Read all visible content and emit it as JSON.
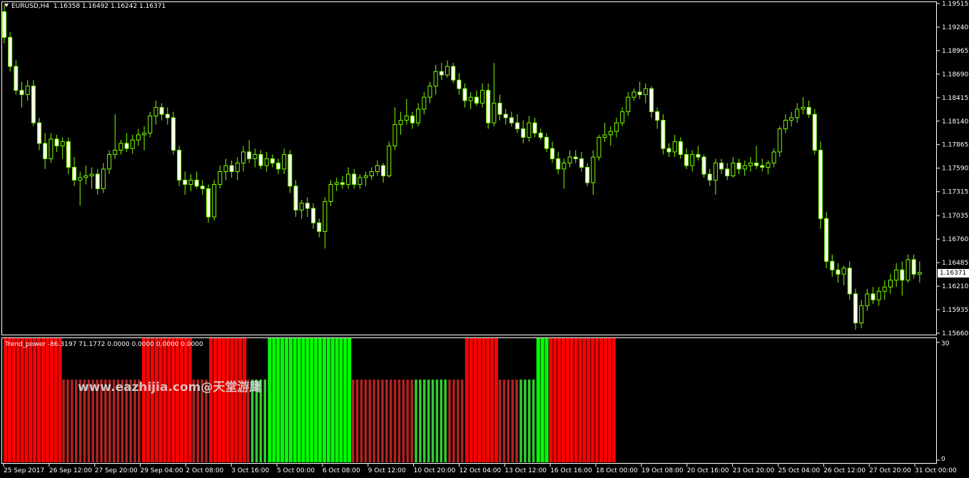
{
  "header": {
    "symbol": "EURUSD,H4",
    "ohlc": "1.16358 1.16492 1.16242 1.16371"
  },
  "price_axis": {
    "ticks": [
      "1.19515",
      "1.19240",
      "1.18965",
      "1.18690",
      "1.18415",
      "1.18140",
      "1.17865",
      "1.17590",
      "1.17315",
      "1.17035",
      "1.16760",
      "1.16485",
      "1.16210",
      "1.15935",
      "1.15660"
    ],
    "last_price": "1.16371"
  },
  "time_axis": {
    "labels": [
      "25 Sep 2017",
      "26 Sep 12:00",
      "27 Sep 20:00",
      "29 Sep 04:00",
      "2 Oct 08:00",
      "3 Oct 16:00",
      "5 Oct 00:00",
      "6 Oct 08:00",
      "9 Oct 12:00",
      "10 Oct 20:00",
      "12 Oct 04:00",
      "13 Oct 12:00",
      "16 Oct 16:00",
      "18 Oct 00:00",
      "19 Oct 08:00",
      "20 Oct 16:00",
      "23 Oct 20:00",
      "25 Oct 04:00",
      "26 Oct 12:00",
      "27 Oct 20:00",
      "31 Oct 00:00"
    ]
  },
  "indicator": {
    "header": "Trend_power -86.3197 71.1772 0.0000 0.0000 0.0000 0.0000",
    "axis_max": "30",
    "axis_min": "0"
  },
  "watermark": "www.eazhijia.com@天堂游鹰",
  "colors": {
    "background": "#000000",
    "candle": "#7CFC00",
    "candle_body_bull": "#000000",
    "candle_body_bear": "#ffffff",
    "strong_down": "#ff0000",
    "weak_down": "#b22222",
    "strong_up": "#00ff00",
    "weak_up": "#32cd32",
    "axis": "#ffffff"
  },
  "chart_data": {
    "type": "candlestick",
    "price_range": [
      1.1566,
      1.19515
    ],
    "indicator_range": [
      0,
      30
    ],
    "indicator_levels": {
      "strong": 30,
      "weak": 20
    },
    "candles": [
      [
        1.1942,
        1.195,
        1.1905,
        1.1912
      ],
      [
        1.1912,
        1.1918,
        1.1872,
        1.1878
      ],
      [
        1.1878,
        1.1885,
        1.1845,
        1.185
      ],
      [
        1.185,
        1.186,
        1.183,
        1.1845
      ],
      [
        1.1845,
        1.1862,
        1.1838,
        1.1855
      ],
      [
        1.1855,
        1.1862,
        1.1808,
        1.1812
      ],
      [
        1.1812,
        1.1818,
        1.178,
        1.1788
      ],
      [
        1.1788,
        1.18,
        1.1758,
        1.177
      ],
      [
        1.177,
        1.18,
        1.1765,
        1.1793
      ],
      [
        1.1793,
        1.1798,
        1.1778,
        1.1785
      ],
      [
        1.1785,
        1.1795,
        1.177,
        1.179
      ],
      [
        1.179,
        1.1795,
        1.1752,
        1.176
      ],
      [
        1.176,
        1.1772,
        1.1738,
        1.1745
      ],
      [
        1.1745,
        1.1755,
        1.1715,
        1.1748
      ],
      [
        1.1748,
        1.1762,
        1.174,
        1.175
      ],
      [
        1.175,
        1.176,
        1.1735,
        1.1752
      ],
      [
        1.1752,
        1.1758,
        1.1728,
        1.1735
      ],
      [
        1.1735,
        1.1765,
        1.173,
        1.1758
      ],
      [
        1.1758,
        1.178,
        1.1752,
        1.1775
      ],
      [
        1.1775,
        1.1822,
        1.177,
        1.178
      ],
      [
        1.178,
        1.1792,
        1.1775,
        1.1788
      ],
      [
        1.1788,
        1.18,
        1.1778,
        1.1782
      ],
      [
        1.1782,
        1.1798,
        1.1776,
        1.1792
      ],
      [
        1.1792,
        1.1805,
        1.1785,
        1.1798
      ],
      [
        1.1798,
        1.1808,
        1.178,
        1.18
      ],
      [
        1.18,
        1.1825,
        1.1795,
        1.182
      ],
      [
        1.182,
        1.1838,
        1.181,
        1.183
      ],
      [
        1.183,
        1.1835,
        1.1815,
        1.1822
      ],
      [
        1.1822,
        1.183,
        1.181,
        1.1818
      ],
      [
        1.1818,
        1.1825,
        1.1775,
        1.178
      ],
      [
        1.178,
        1.1785,
        1.1738,
        1.1745
      ],
      [
        1.1745,
        1.1755,
        1.1728,
        1.174
      ],
      [
        1.174,
        1.1752,
        1.1732,
        1.1745
      ],
      [
        1.1745,
        1.1755,
        1.1735,
        1.1738
      ],
      [
        1.1738,
        1.1745,
        1.1728,
        1.1735
      ],
      [
        1.1735,
        1.174,
        1.1695,
        1.1702
      ],
      [
        1.1702,
        1.1745,
        1.1698,
        1.174
      ],
      [
        1.174,
        1.1762,
        1.1735,
        1.1755
      ],
      [
        1.1755,
        1.177,
        1.1745,
        1.1762
      ],
      [
        1.1762,
        1.1768,
        1.1748,
        1.1755
      ],
      [
        1.1755,
        1.1772,
        1.1745,
        1.1765
      ],
      [
        1.1765,
        1.1785,
        1.1755,
        1.1778
      ],
      [
        1.1778,
        1.1792,
        1.1765,
        1.177
      ],
      [
        1.177,
        1.1782,
        1.176,
        1.1775
      ],
      [
        1.1775,
        1.178,
        1.1758,
        1.1762
      ],
      [
        1.1762,
        1.1778,
        1.1755,
        1.177
      ],
      [
        1.177,
        1.1775,
        1.176,
        1.1765
      ],
      [
        1.1765,
        1.177,
        1.1752,
        1.1758
      ],
      [
        1.1758,
        1.1782,
        1.1752,
        1.1775
      ],
      [
        1.1775,
        1.178,
        1.173,
        1.1738
      ],
      [
        1.1738,
        1.1745,
        1.1702,
        1.171
      ],
      [
        1.171,
        1.1722,
        1.17,
        1.1718
      ],
      [
        1.1718,
        1.1725,
        1.1702,
        1.1712
      ],
      [
        1.1712,
        1.1718,
        1.1688,
        1.1695
      ],
      [
        1.1695,
        1.17,
        1.1678,
        1.1685
      ],
      [
        1.1685,
        1.1725,
        1.1665,
        1.172
      ],
      [
        1.172,
        1.1745,
        1.1715,
        1.174
      ],
      [
        1.174,
        1.1748,
        1.1732,
        1.1742
      ],
      [
        1.1742,
        1.175,
        1.1735,
        1.174
      ],
      [
        1.174,
        1.176,
        1.1735,
        1.1752
      ],
      [
        1.1752,
        1.1758,
        1.1735,
        1.174
      ],
      [
        1.174,
        1.1752,
        1.1735,
        1.1748
      ],
      [
        1.1748,
        1.1755,
        1.1738,
        1.175
      ],
      [
        1.175,
        1.176,
        1.1745,
        1.1755
      ],
      [
        1.1755,
        1.1768,
        1.175,
        1.1762
      ],
      [
        1.1762,
        1.1765,
        1.1742,
        1.175
      ],
      [
        1.175,
        1.179,
        1.1748,
        1.1785
      ],
      [
        1.1785,
        1.183,
        1.178,
        1.181
      ],
      [
        1.181,
        1.1825,
        1.1798,
        1.1815
      ],
      [
        1.1815,
        1.184,
        1.181,
        1.182
      ],
      [
        1.182,
        1.1825,
        1.1805,
        1.1812
      ],
      [
        1.1812,
        1.1835,
        1.1808,
        1.1828
      ],
      [
        1.1828,
        1.1848,
        1.1822,
        1.1842
      ],
      [
        1.1842,
        1.186,
        1.1835,
        1.1855
      ],
      [
        1.1855,
        1.188,
        1.1845,
        1.1872
      ],
      [
        1.1872,
        1.1882,
        1.1862,
        1.1868
      ],
      [
        1.1868,
        1.1885,
        1.1865,
        1.1878
      ],
      [
        1.1878,
        1.1882,
        1.1858,
        1.1862
      ],
      [
        1.1862,
        1.187,
        1.1845,
        1.1852
      ],
      [
        1.1852,
        1.1858,
        1.183,
        1.1838
      ],
      [
        1.1838,
        1.1848,
        1.1828,
        1.1842
      ],
      [
        1.1842,
        1.185,
        1.1832,
        1.1835
      ],
      [
        1.1835,
        1.1858,
        1.183,
        1.185
      ],
      [
        1.185,
        1.1858,
        1.1805,
        1.1812
      ],
      [
        1.1812,
        1.1882,
        1.1808,
        1.1835
      ],
      [
        1.1835,
        1.1845,
        1.1815,
        1.1822
      ],
      [
        1.1822,
        1.1828,
        1.181,
        1.1818
      ],
      [
        1.1818,
        1.1825,
        1.1808,
        1.1812
      ],
      [
        1.1812,
        1.1822,
        1.18,
        1.1805
      ],
      [
        1.1805,
        1.1815,
        1.1788,
        1.1795
      ],
      [
        1.1795,
        1.182,
        1.179,
        1.1812
      ],
      [
        1.1812,
        1.1818,
        1.1795,
        1.18
      ],
      [
        1.18,
        1.1805,
        1.1792,
        1.1795
      ],
      [
        1.1795,
        1.18,
        1.1778,
        1.1782
      ],
      [
        1.1782,
        1.179,
        1.1765,
        1.177
      ],
      [
        1.177,
        1.1778,
        1.1752,
        1.1758
      ],
      [
        1.1758,
        1.177,
        1.1735,
        1.1765
      ],
      [
        1.1765,
        1.178,
        1.176,
        1.1772
      ],
      [
        1.1772,
        1.178,
        1.1765,
        1.177
      ],
      [
        1.177,
        1.1778,
        1.1755,
        1.176
      ],
      [
        1.176,
        1.1765,
        1.1738,
        1.1742
      ],
      [
        1.1742,
        1.178,
        1.1728,
        1.1772
      ],
      [
        1.1772,
        1.1798,
        1.1768,
        1.1795
      ],
      [
        1.1795,
        1.1812,
        1.179,
        1.1798
      ],
      [
        1.1798,
        1.1808,
        1.1785,
        1.1802
      ],
      [
        1.1802,
        1.1818,
        1.1795,
        1.1812
      ],
      [
        1.1812,
        1.183,
        1.1808,
        1.1825
      ],
      [
        1.1825,
        1.1848,
        1.182,
        1.1842
      ],
      [
        1.1842,
        1.1852,
        1.1838,
        1.1848
      ],
      [
        1.1848,
        1.186,
        1.184,
        1.1845
      ],
      [
        1.1845,
        1.1858,
        1.1835,
        1.1852
      ],
      [
        1.1852,
        1.1855,
        1.1818,
        1.1825
      ],
      [
        1.1825,
        1.183,
        1.1805,
        1.1815
      ],
      [
        1.1815,
        1.1822,
        1.1775,
        1.1782
      ],
      [
        1.1782,
        1.1788,
        1.1772,
        1.1778
      ],
      [
        1.1778,
        1.1798,
        1.1772,
        1.179
      ],
      [
        1.179,
        1.1795,
        1.177,
        1.1775
      ],
      [
        1.1775,
        1.1782,
        1.1758,
        1.1762
      ],
      [
        1.1762,
        1.178,
        1.1755,
        1.1775
      ],
      [
        1.1775,
        1.1785,
        1.1768,
        1.1772
      ],
      [
        1.1772,
        1.1775,
        1.1748,
        1.1752
      ],
      [
        1.1752,
        1.1758,
        1.1738,
        1.1745
      ],
      [
        1.1745,
        1.177,
        1.1728,
        1.1765
      ],
      [
        1.1765,
        1.177,
        1.1752,
        1.1758
      ],
      [
        1.1758,
        1.1765,
        1.1745,
        1.175
      ],
      [
        1.175,
        1.1772,
        1.1748,
        1.1765
      ],
      [
        1.1765,
        1.177,
        1.1752,
        1.1758
      ],
      [
        1.1758,
        1.1768,
        1.175,
        1.1762
      ],
      [
        1.1762,
        1.1772,
        1.1755,
        1.1765
      ],
      [
        1.1765,
        1.1785,
        1.1758,
        1.1762
      ],
      [
        1.1762,
        1.177,
        1.1755,
        1.176
      ],
      [
        1.176,
        1.1768,
        1.1752,
        1.1765
      ],
      [
        1.1765,
        1.1782,
        1.176,
        1.1778
      ],
      [
        1.1778,
        1.1808,
        1.1772,
        1.1805
      ],
      [
        1.1805,
        1.1822,
        1.18,
        1.1815
      ],
      [
        1.1815,
        1.1825,
        1.1808,
        1.1818
      ],
      [
        1.1818,
        1.1835,
        1.1812,
        1.1828
      ],
      [
        1.1828,
        1.1842,
        1.1822,
        1.183
      ],
      [
        1.183,
        1.1838,
        1.1818,
        1.1822
      ],
      [
        1.1822,
        1.1828,
        1.1775,
        1.178
      ],
      [
        1.178,
        1.179,
        1.1688,
        1.17
      ],
      [
        1.17,
        1.1708,
        1.1642,
        1.165
      ],
      [
        1.165,
        1.1658,
        1.1632,
        1.164
      ],
      [
        1.164,
        1.1648,
        1.1625,
        1.1635
      ],
      [
        1.1635,
        1.1645,
        1.1622,
        1.1642
      ],
      [
        1.1642,
        1.165,
        1.1605,
        1.1612
      ],
      [
        1.1612,
        1.1618,
        1.157,
        1.1578
      ],
      [
        1.1578,
        1.1605,
        1.1572,
        1.1598
      ],
      [
        1.1598,
        1.1618,
        1.1592,
        1.1612
      ],
      [
        1.1612,
        1.162,
        1.16,
        1.1605
      ],
      [
        1.1605,
        1.162,
        1.1598,
        1.1615
      ],
      [
        1.1615,
        1.1628,
        1.1605,
        1.162
      ],
      [
        1.162,
        1.1635,
        1.1612,
        1.1628
      ],
      [
        1.1628,
        1.1648,
        1.162,
        1.164
      ],
      [
        1.164,
        1.165,
        1.161,
        1.1628
      ],
      [
        1.1628,
        1.1658,
        1.1625,
        1.1652
      ],
      [
        1.1652,
        1.1658,
        1.163,
        1.1635
      ],
      [
        1.1635,
        1.165,
        1.1625,
        1.1637
      ]
    ],
    "indicator_bars": [
      [
        "strong_down",
        0
      ],
      [
        "strong_down",
        14
      ],
      [
        "weak_down",
        0
      ],
      [
        "weak_down",
        19
      ],
      [
        "strong_down",
        12
      ],
      [
        "weak_down",
        4
      ],
      [
        "strong_down",
        9
      ],
      [
        "weak_down",
        1
      ],
      [
        "weak_up",
        4
      ],
      [
        "strong_up",
        19
      ],
      [
        "strong_up",
        1
      ],
      [
        "weak_down",
        15
      ],
      [
        "weak_up",
        8
      ],
      [
        "weak_down",
        4
      ],
      [
        "strong_down",
        8
      ],
      [
        "weak_down",
        4
      ],
      [
        "weak_down",
        1
      ],
      [
        "weak_up",
        4
      ],
      [
        "strong_up",
        3
      ],
      [
        "strong_down",
        16
      ]
    ]
  }
}
